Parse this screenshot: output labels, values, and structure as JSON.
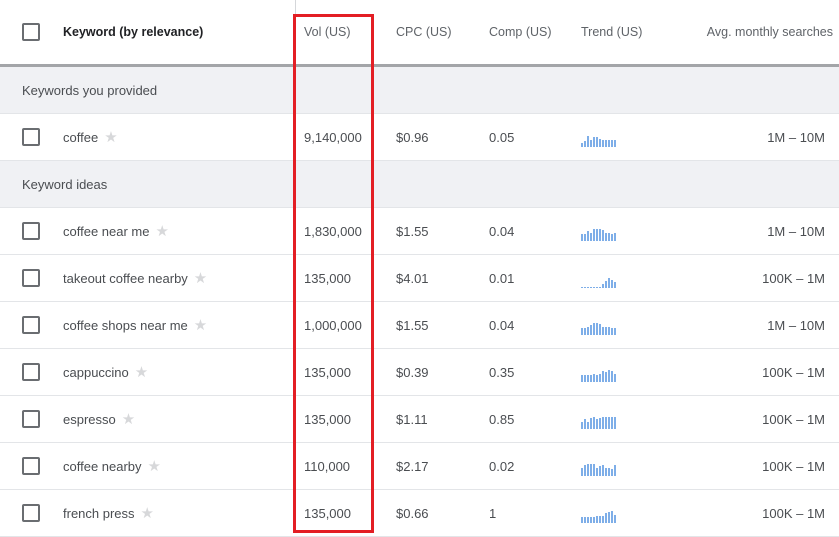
{
  "columns": {
    "keyword": "Keyword (by relevance)",
    "vol": "Vol (US)",
    "cpc": "CPC (US)",
    "comp": "Comp (US)",
    "trend": "Trend (US)",
    "avg": "Avg. monthly searches"
  },
  "groups": [
    {
      "label": "Keywords you provided",
      "rows": [
        {
          "keyword": "coffee",
          "vol": "9,140,000",
          "cpc": "$0.96",
          "comp": "0.05",
          "avg": "1M – 10M",
          "trend": [
            0.3,
            0.5,
            0.9,
            0.6,
            0.8,
            0.8,
            0.7,
            0.6,
            0.6,
            0.6,
            0.6,
            0.6
          ]
        }
      ]
    },
    {
      "label": "Keyword ideas",
      "rows": [
        {
          "keyword": "coffee near me",
          "vol": "1,830,000",
          "cpc": "$1.55",
          "comp": "0.04",
          "avg": "1M – 10M",
          "trend": [
            0.6,
            0.6,
            0.8,
            0.7,
            1.0,
            1.0,
            1.0,
            0.9,
            0.7,
            0.7,
            0.6,
            0.7
          ]
        },
        {
          "keyword": "takeout coffee nearby",
          "vol": "135,000",
          "cpc": "$4.01",
          "comp": "0.01",
          "avg": "100K – 1M",
          "trend": [
            0.1,
            0.1,
            0.1,
            0.1,
            0.1,
            0.1,
            0.1,
            0.3,
            0.6,
            0.8,
            0.7,
            0.5
          ]
        },
        {
          "keyword": "coffee shops near me",
          "vol": "1,000,000",
          "cpc": "$1.55",
          "comp": "0.04",
          "avg": "1M – 10M",
          "trend": [
            0.6,
            0.6,
            0.7,
            0.8,
            1.0,
            1.0,
            0.9,
            0.7,
            0.7,
            0.7,
            0.6,
            0.6
          ]
        },
        {
          "keyword": "cappuccino",
          "vol": "135,000",
          "cpc": "$0.39",
          "comp": "0.35",
          "avg": "100K – 1M",
          "trend": [
            0.6,
            0.6,
            0.6,
            0.6,
            0.7,
            0.6,
            0.7,
            0.9,
            0.8,
            1.0,
            0.9,
            0.7
          ]
        },
        {
          "keyword": "espresso",
          "vol": "135,000",
          "cpc": "$1.11",
          "comp": "0.85",
          "avg": "100K – 1M",
          "trend": [
            0.6,
            0.8,
            0.6,
            0.9,
            1.0,
            0.8,
            0.9,
            1.0,
            1.0,
            1.0,
            1.0,
            1.0
          ]
        },
        {
          "keyword": "coffee nearby",
          "vol": "110,000",
          "cpc": "$2.17",
          "comp": "0.02",
          "avg": "100K – 1M",
          "trend": [
            0.7,
            0.9,
            1.0,
            1.0,
            1.0,
            0.7,
            0.8,
            0.9,
            0.7,
            0.7,
            0.6,
            0.9
          ]
        },
        {
          "keyword": "french press",
          "vol": "135,000",
          "cpc": "$0.66",
          "comp": "1",
          "avg": "100K – 1M",
          "trend": [
            0.5,
            0.5,
            0.5,
            0.5,
            0.5,
            0.6,
            0.6,
            0.6,
            0.8,
            0.9,
            1.0,
            0.7
          ]
        }
      ]
    }
  ],
  "colors": {
    "highlight": "#e31e24",
    "trend_bar": "#7eaee8",
    "group_bg": "#f0f1f4"
  }
}
